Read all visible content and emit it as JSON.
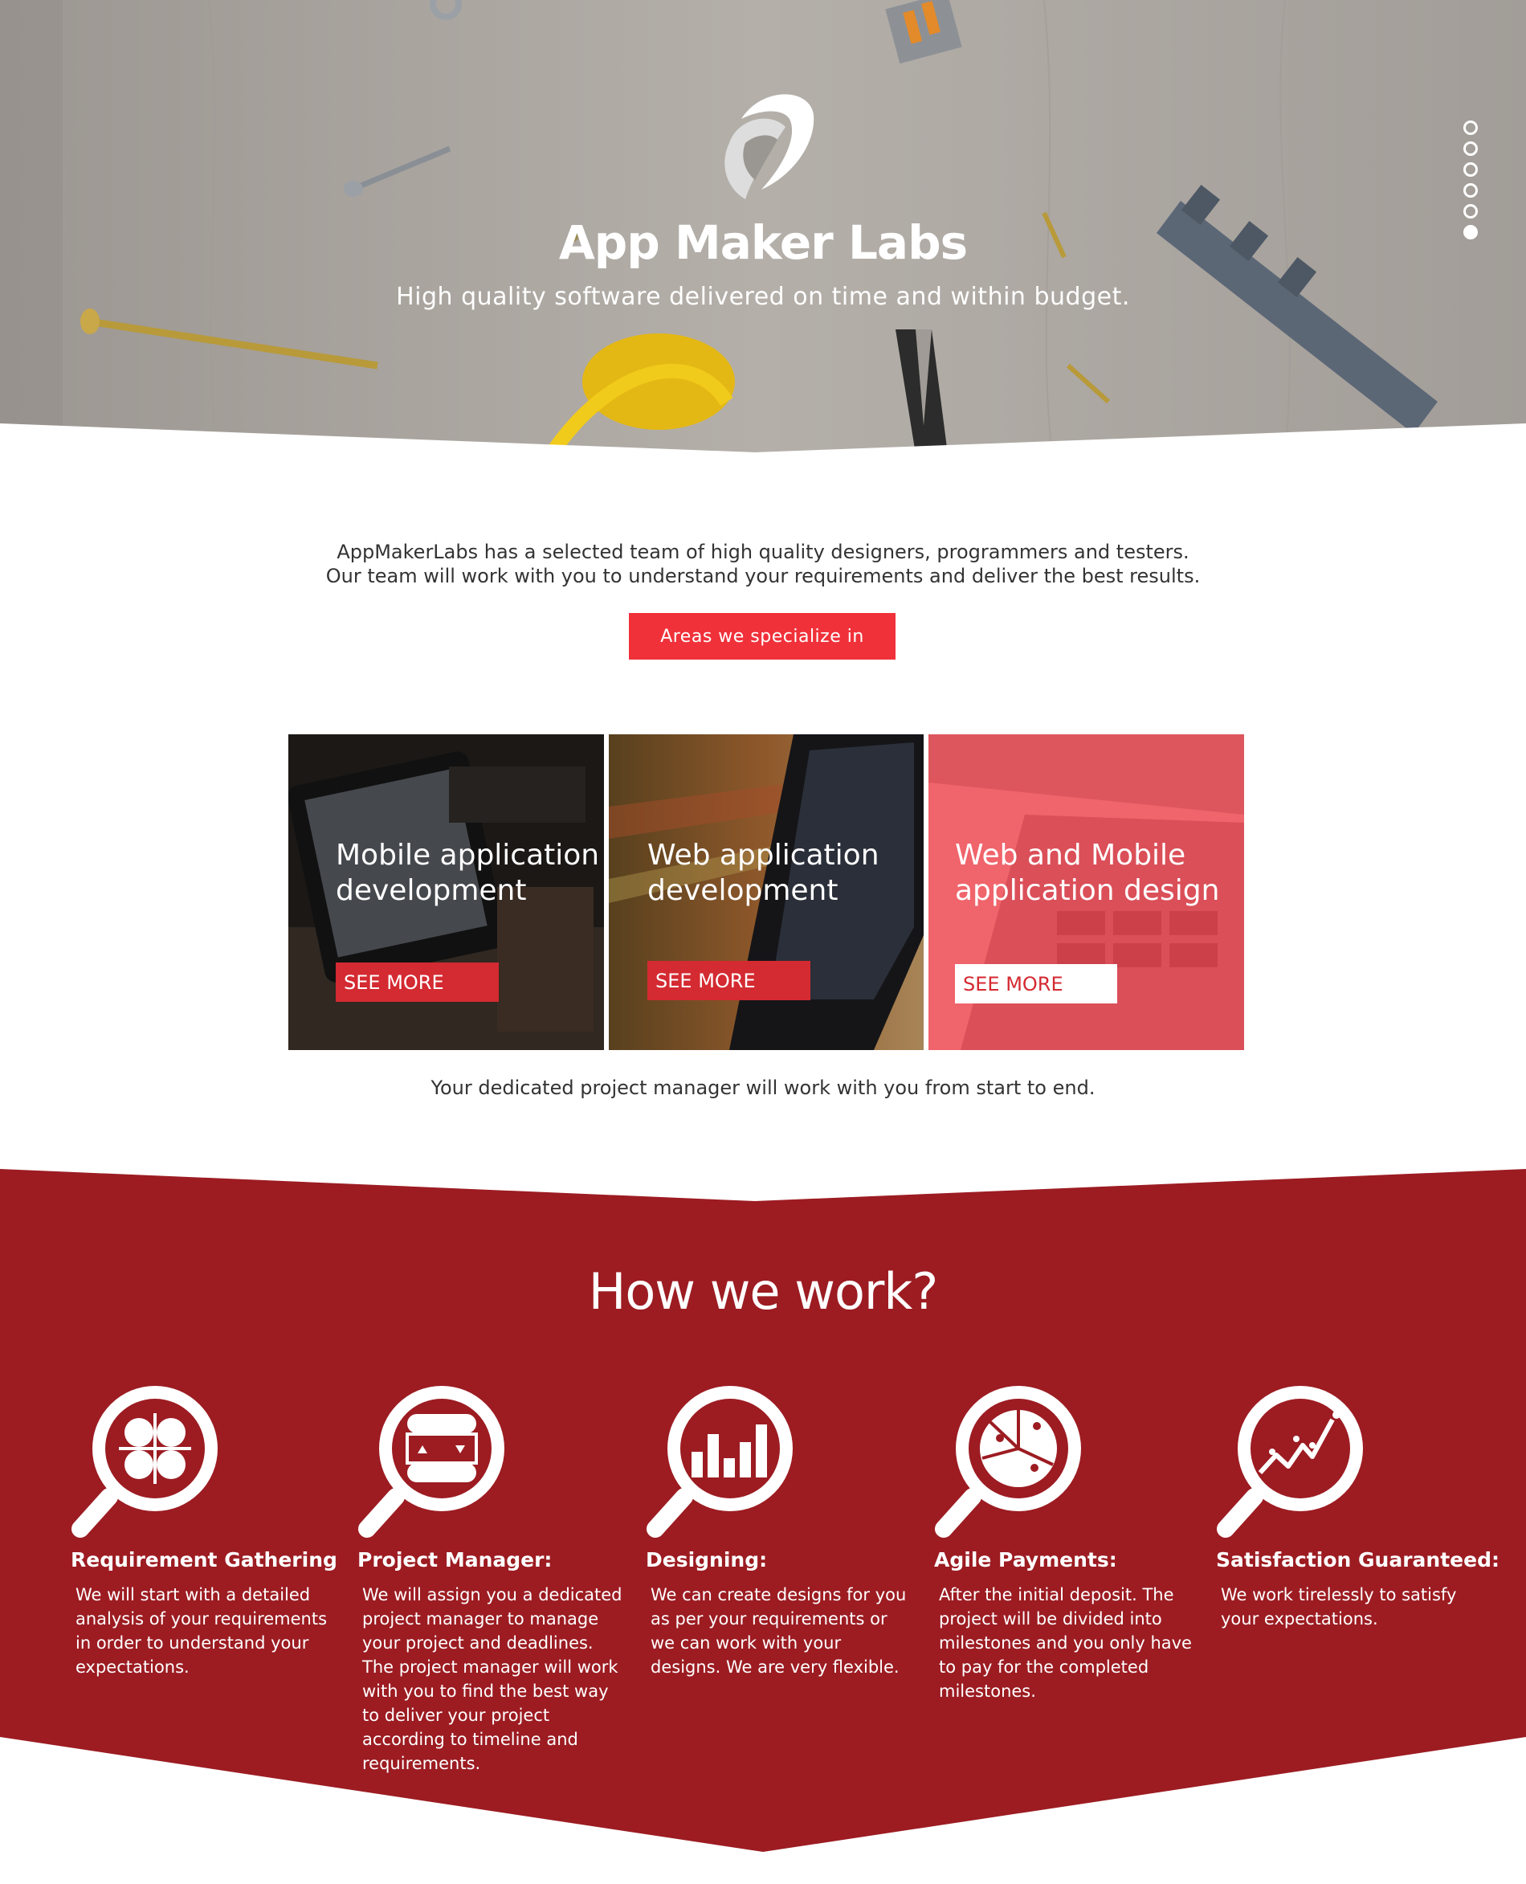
{
  "hero": {
    "title": "App Maker Labs",
    "subtitle": "High quality software delivered on time and within budget.",
    "logo_icon": "ribbon-logo-icon",
    "slides": [
      {
        "active": false
      },
      {
        "active": false
      },
      {
        "active": false
      },
      {
        "active": false
      },
      {
        "active": false
      },
      {
        "active": true
      }
    ]
  },
  "intro": {
    "line1": "AppMakerLabs has a selected team of high quality designers, programmers and testers.",
    "line2": "Our team will work with you to understand your requirements and deliver the best results.",
    "cta_label": "Areas we specialize in"
  },
  "cards": [
    {
      "title": "Mobile application development",
      "button": "SEE MORE"
    },
    {
      "title": "Web application development",
      "button": "SEE MORE"
    },
    {
      "title": "Web and Mobile application design",
      "button": "SEE MORE"
    }
  ],
  "pm_line": "Your dedicated project manager will work with you from start to end.",
  "how": {
    "heading": "How we work?",
    "steps": [
      {
        "icon": "requirements-magnifier-icon",
        "title": "Requirement Gathering",
        "text": "We will start with a detailed analysis of your requirements in order to understand your expectations."
      },
      {
        "icon": "project-manager-magnifier-icon",
        "title": "Project Manager:",
        "text": "We will assign you a dedicated project manager to manage your project and deadlines. The project manager will work with you to find the best way to deliver your project according to timeline and requirements."
      },
      {
        "icon": "bar-chart-magnifier-icon",
        "title": "Designing:",
        "text": "We can create designs for you as per your requirements or we can work with your designs. We are very flexible."
      },
      {
        "icon": "pie-chart-magnifier-icon",
        "title": "Agile Payments:",
        "text": "After the initial deposit. The project will be divided into milestones and you only have to pay for the completed milestones."
      },
      {
        "icon": "trend-line-magnifier-icon",
        "title": "Satisfaction Guaranteed:",
        "text": "We work tirelessly to satisfy your expectations."
      }
    ]
  },
  "colors": {
    "accent_red": "#f0313a",
    "button_red": "#d42a31",
    "section_red": "#9c1c22",
    "text_dark": "#333333"
  }
}
